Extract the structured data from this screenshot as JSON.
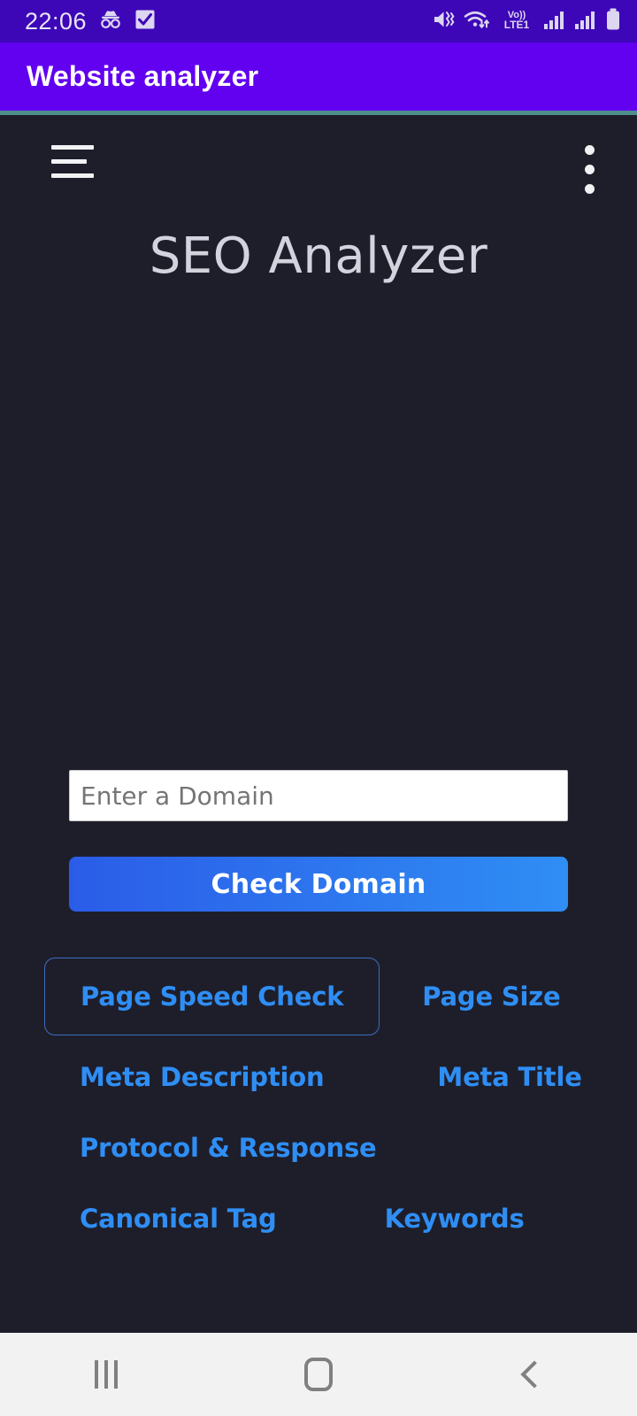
{
  "status_bar": {
    "time": "22:06",
    "left_icons": [
      "incognito-icon",
      "task-checkbox-icon"
    ],
    "right_icons": [
      "mute-vibrate-icon",
      "wifi-transfer-icon",
      "volte-icon",
      "signal-bars-1-icon",
      "signal-bars-2-icon",
      "battery-icon"
    ],
    "network_label": "Vo))",
    "network_sub": "LTE1",
    "background": "#3d07b8"
  },
  "app_bar": {
    "title": "Website analyzer",
    "background": "#6200f0",
    "accent_divider": "#4e8f8c"
  },
  "web_page": {
    "menu_icon": "hamburger-menu-icon",
    "overflow_icon": "kebab-menu-icon",
    "heading": "SEO Analyzer",
    "background": "#1e1e2b",
    "heading_color": "#d2d3dc",
    "form": {
      "input_value": "",
      "input_placeholder": "Enter a Domain",
      "submit_label": "Check Domain",
      "submit_gradient_start": "#2b5ce8",
      "submit_gradient_end": "#2f8ef4"
    },
    "link_color": "#2f8ef4",
    "links": [
      {
        "label": "Page Speed Check",
        "focused": true
      },
      {
        "label": "Page Size",
        "focused": false
      },
      {
        "label": "Meta Description",
        "focused": false
      },
      {
        "label": "Meta Title",
        "focused": false
      },
      {
        "label": "Protocol & Response",
        "focused": false
      },
      {
        "label": "Canonical Tag",
        "focused": false
      },
      {
        "label": "Keywords",
        "focused": false
      }
    ]
  },
  "nav_bar": {
    "background": "#f2f2f2",
    "buttons": [
      {
        "name": "recents-button",
        "icon": "recents-icon"
      },
      {
        "name": "home-button",
        "icon": "home-icon"
      },
      {
        "name": "back-button",
        "icon": "back-chevron-icon"
      }
    ]
  }
}
